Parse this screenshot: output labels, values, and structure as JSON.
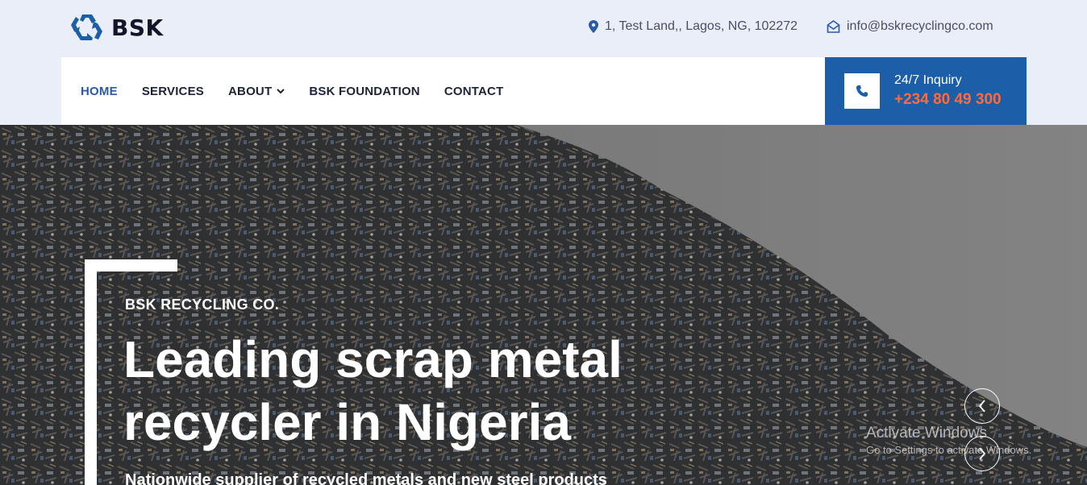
{
  "brand": {
    "name": "BSK"
  },
  "header": {
    "address": "1, Test Land,, Lagos, NG, 102272",
    "email": "info@bskrecyclingco.com"
  },
  "nav": {
    "items": [
      {
        "label": "HOME",
        "active": true
      },
      {
        "label": "SERVICES"
      },
      {
        "label": "ABOUT",
        "has_dropdown": true
      },
      {
        "label": "BSK FOUNDATION"
      },
      {
        "label": "CONTACT"
      }
    ]
  },
  "inquiry": {
    "label": "24/7 Inquiry",
    "phone": "+234 80 49 300"
  },
  "hero": {
    "eyebrow": "BSK RECYCLING CO.",
    "title": "Leading scrap metal recycler in Nigeria",
    "description": "Nationwide supplier of recycled metals and new steel products"
  },
  "watermark": {
    "title": "Activate Windows",
    "subtitle": "Go to Settings to activate Windows."
  },
  "icons": {
    "logo": "recycle-icon",
    "address": "map-pin-icon",
    "email": "envelope-open-icon",
    "phone": "phone-icon",
    "dropdown": "chevron-down-icon",
    "prev": "chevron-left-icon",
    "next": "chevron-right-icon"
  },
  "colors": {
    "topbar_bg": "#e9eef9",
    "accent_blue": "#1c5ea8",
    "active_nav": "#2b5aa8",
    "phone_orange": "#ff6a3d",
    "text_dark": "#1e2338"
  }
}
